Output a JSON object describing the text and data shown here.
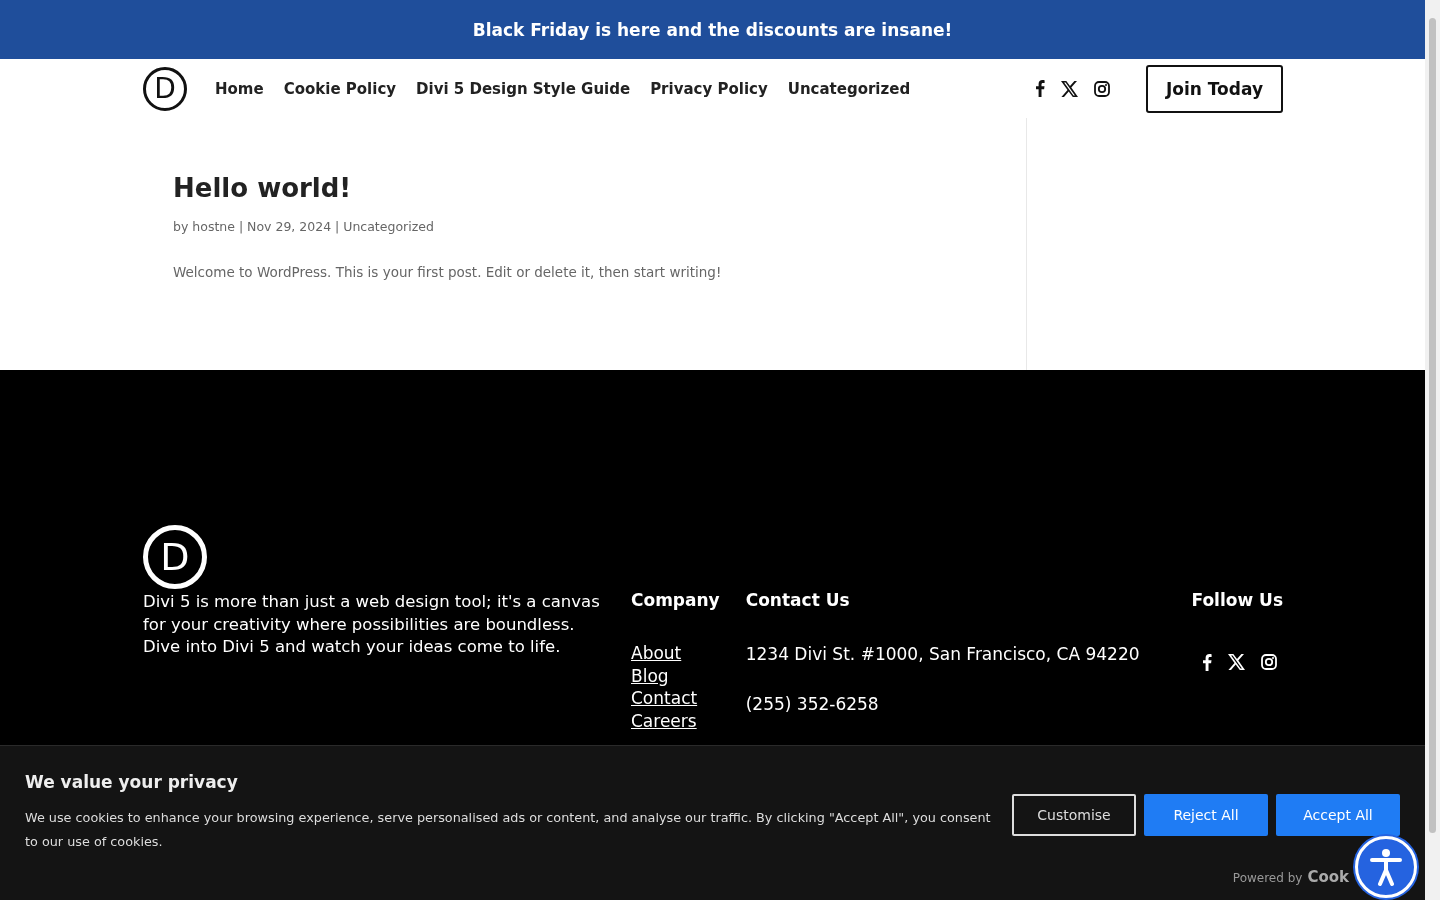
{
  "banner": {
    "text": "Black Friday is here and the discounts are insane!"
  },
  "header": {
    "logo_letter": "D",
    "nav": [
      "Home",
      "Cookie Policy",
      "Divi 5 Design Style Guide",
      "Privacy Policy",
      "Uncategorized"
    ],
    "social": [
      {
        "kind": "facebook"
      },
      {
        "kind": "x"
      },
      {
        "kind": "instagram"
      }
    ],
    "cta": "Join Today"
  },
  "post": {
    "title": "Hello world!",
    "meta": "by hostne | Nov 29, 2024 | Uncategorized",
    "excerpt": "Welcome to WordPress. This is your first post. Edit or delete it, then start writing!"
  },
  "footer": {
    "logo_letter": "D",
    "about": "Divi 5 is more than just a web design tool; it's a canvas for your creativity where possibilities are boundless. Dive into Divi 5 and watch your ideas come to life.",
    "company": {
      "heading": "Company",
      "links": [
        "About",
        "Blog",
        "Contact",
        "Careers"
      ]
    },
    "contact": {
      "heading": "Contact Us",
      "address": "1234 Divi St. #1000, San Francisco, CA 94220",
      "phone": "(255) 352-6258"
    },
    "follow": {
      "heading": "Follow Us",
      "social": [
        {
          "kind": "facebook"
        },
        {
          "kind": "x"
        },
        {
          "kind": "instagram"
        }
      ]
    }
  },
  "cookie_bar": {
    "title": "We value your privacy",
    "text": "We use cookies to enhance your browsing experience, serve personalised ads or content, and analyse our traffic. By clicking \"Accept All\", you consent to our use of cookies.",
    "buttons": [
      {
        "label": "Customise",
        "kind": "outline"
      },
      {
        "label": "Reject All",
        "kind": "filled"
      },
      {
        "label": "Accept All",
        "kind": "filled"
      }
    ],
    "powered_by": "Powered by",
    "brand": "Cook"
  }
}
